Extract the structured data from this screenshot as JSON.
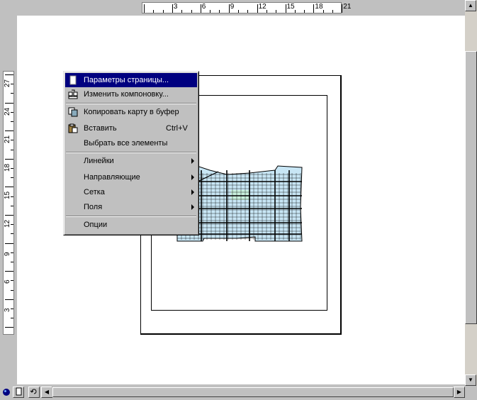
{
  "ruler_horizontal": {
    "labels": [
      "3",
      "6",
      "9",
      "12",
      "15",
      "18",
      "21"
    ]
  },
  "ruler_vertical": {
    "labels": [
      "27",
      "24",
      "21",
      "18",
      "15",
      "12",
      "9",
      "6",
      "3"
    ]
  },
  "context_menu": {
    "items": [
      {
        "label": "Параметры страницы...",
        "shortcut": "",
        "icon": "page-setup-icon",
        "submenu": false,
        "selected": true
      },
      {
        "label": "Изменить компоновку...",
        "shortcut": "",
        "icon": "layout-icon",
        "submenu": false,
        "selected": false
      },
      {
        "label": "Копировать карту в буфер",
        "shortcut": "",
        "icon": "copy-icon",
        "submenu": false,
        "selected": false
      },
      {
        "label": "Вставить",
        "shortcut": "Ctrl+V",
        "icon": "paste-icon",
        "submenu": false,
        "selected": false
      },
      {
        "label": "Выбрать все элементы",
        "shortcut": "",
        "icon": "",
        "submenu": false,
        "selected": false
      },
      {
        "label": "Линейки",
        "shortcut": "",
        "icon": "",
        "submenu": true,
        "selected": false
      },
      {
        "label": "Направляющие",
        "shortcut": "",
        "icon": "",
        "submenu": true,
        "selected": false
      },
      {
        "label": "Сетка",
        "shortcut": "",
        "icon": "",
        "submenu": true,
        "selected": false
      },
      {
        "label": "Поля",
        "shortcut": "",
        "icon": "",
        "submenu": true,
        "selected": false
      },
      {
        "label": "Опции",
        "shortcut": "",
        "icon": "",
        "submenu": false,
        "selected": false
      }
    ]
  },
  "colors": {
    "selection": "#000080",
    "map_fill": "#c8e6f5",
    "map_highlight": "#c8f0dc",
    "map_line": "#000000"
  }
}
